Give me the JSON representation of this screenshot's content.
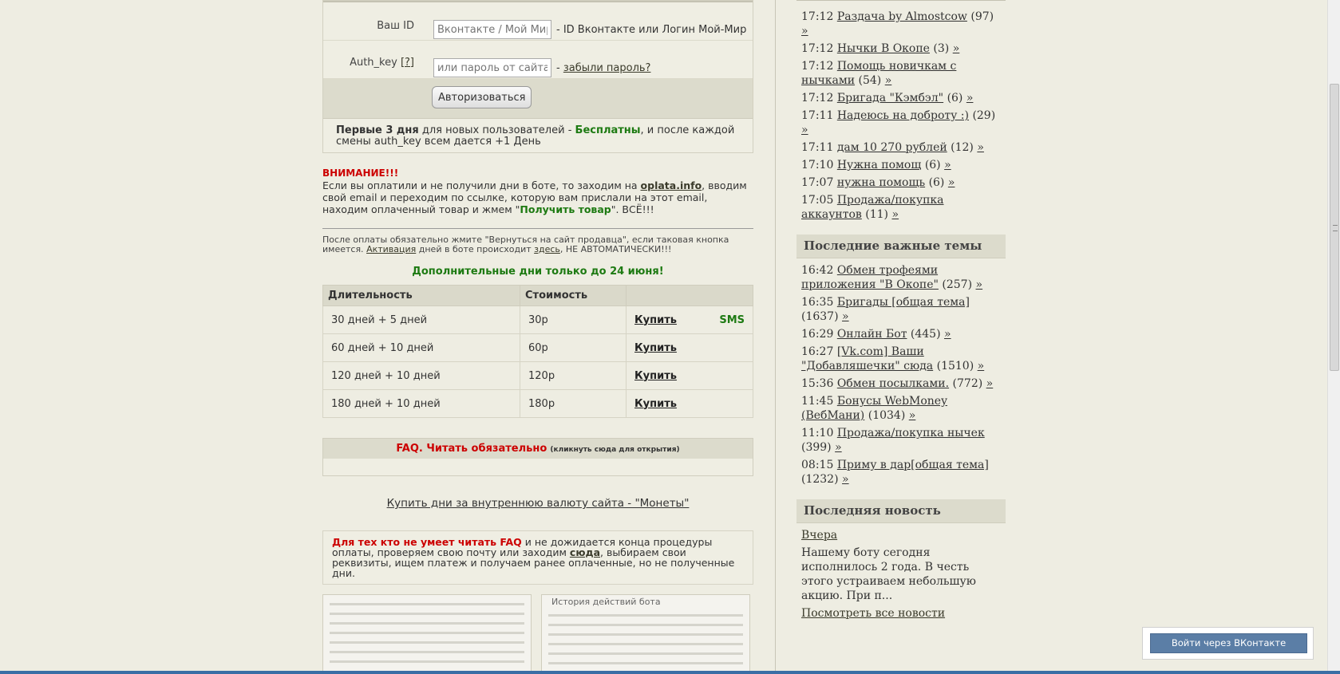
{
  "auth": {
    "id_label": "Ваш ID",
    "id_placeholder": "Вконтакте / Мой Мир",
    "id_hint": "- ID Вконтакте или Логин Мой-Мир",
    "key_label": "Auth_key",
    "key_help": "[?]",
    "key_placeholder": "или пароль от сайта",
    "key_hint_prefix": "-",
    "forgot_link": "забыли пароль?",
    "submit_label": "Авторизоваться",
    "note_bold": "Первые 3 дня",
    "note_mid": " для новых пользователей - ",
    "note_free": "Бесплатны",
    "note_end": ", и после каждой смены auth_key всем дается +1 День"
  },
  "warning": {
    "title": "ВНИМАНИЕ!!!",
    "text_1": "Если вы оплатили и не получили дни в боте, то заходим на ",
    "link": "oplata.info",
    "text_2": ", вводим свой email и переходим по ссылке, которую вам прислали на этот email, находим оплаченный товар и жмем \"",
    "get_goods": "Получить товар",
    "text_3": "\". ВСЁ!!!"
  },
  "after_pay": {
    "text_1": "После оплаты обязательно жмите \"Вернуться на сайт продавца\", если таковая кнопка имеется. ",
    "activation_link": "Активация",
    "text_2": " дней в боте происходит ",
    "here_link": "здесь",
    "text_3": ", НЕ АВТОМАТИЧЕСКИ!!!"
  },
  "promo": "Дополнительные дни только до 24 июня!",
  "prices": {
    "col_duration": "Длительность",
    "col_price": "Стоимость",
    "buy_label": "Купить",
    "sms_label": "SMS",
    "rows": [
      {
        "duration": "30 дней + 5 дней",
        "price": "30р"
      },
      {
        "duration": "60 дней + 10 дней",
        "price": "60р"
      },
      {
        "duration": "120 дней + 10 дней",
        "price": "120р"
      },
      {
        "duration": "180 дней + 10 дней",
        "price": "180р"
      }
    ]
  },
  "faq": {
    "title": "FAQ. Читать обязательно",
    "subtitle": "(кликнуть сюда для открытия)"
  },
  "coins_link": "Купить дни за внутреннюю валюту сайта - \"Монеты\"",
  "lower": {
    "red": "Для тех кто не умеет читать FAQ",
    "text_1": " и не дожидается конца процедуры оплаты, проверяем свою почту или заходим ",
    "here_link": "сюда",
    "text_2": ", выбираем свои реквизиты, ищем платеж и получаем ранее оплаченные, но не полученные дни."
  },
  "screenshot_title": "История действий бота",
  "sidebar": {
    "topics": [
      {
        "time": "17:12",
        "title": "Раздача by Almostcow",
        "count": "(97)"
      },
      {
        "time": "17:12",
        "title": "Нычки В Окопе",
        "count": "(3)"
      },
      {
        "time": "17:12",
        "title": "Помощь новичкам с нычками",
        "count": "(54)"
      },
      {
        "time": "17:12",
        "title": "Бригада \"Кэмбэл\"",
        "count": "(6)"
      },
      {
        "time": "17:11",
        "title": "Надеюсь на доброту :)",
        "count": "(29)"
      },
      {
        "time": "17:11",
        "title": "дам 10 270 рублей",
        "count": "(12)"
      },
      {
        "time": "17:10",
        "title": "Нужна помощ",
        "count": "(6)"
      },
      {
        "time": "17:07",
        "title": "нужна помощь",
        "count": "(6)"
      },
      {
        "time": "17:05",
        "title": "Продажа/покупка аккаунтов",
        "count": "(11)"
      }
    ],
    "important_heading": "Последние важные темы",
    "important": [
      {
        "time": "16:42",
        "title": "Обмен трофеями приложения \"В Окопе\"",
        "count": "(257)"
      },
      {
        "time": "16:35",
        "title": "Бригады [общая тема]",
        "count": "(1637)"
      },
      {
        "time": "16:29",
        "title": "Онлайн Бот",
        "count": "(445)"
      },
      {
        "time": "16:27",
        "title": "[Vk.com] Ваши \"Добавляшечки\" сюда",
        "count": "(1510)"
      },
      {
        "time": "15:36",
        "title": "Обмен посылками.",
        "count": "(772)"
      },
      {
        "time": "11:45",
        "title": "Бонусы WebMoney (ВебМани)",
        "count": "(1034)"
      },
      {
        "time": "11:10",
        "title": "Продажа/покупка нычек",
        "count": "(399)"
      },
      {
        "time": "08:15",
        "title": "Приму в дар[общая тема]",
        "count": "(1232)"
      }
    ],
    "arrow": "»",
    "news_heading": "Последняя новость",
    "news_date": "Вчера",
    "news_text": "Нашему боту сегодня исполнилось 2 года. В честь этого устраиваем небольшую акцию. При п...",
    "all_news": "Посмотреть все новости"
  },
  "vk_login": "Войти через ВКонтакте"
}
